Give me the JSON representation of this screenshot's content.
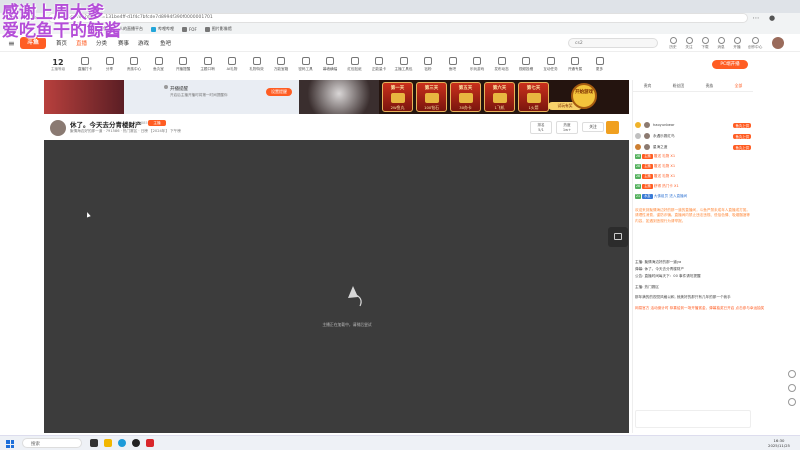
{
  "overlay": {
    "line1": "感谢上周大爹",
    "line2": "爱吃鱼干的鲸酱"
  },
  "browser": {
    "url": "douyu.com/1?dyshid=131be4ff-d1f4c7bfcde7d8994f390f0000001701",
    "bookmarks": [
      "斗鱼 - 每个人的直播平台",
      "哔哩哔哩",
      "FOF",
      "图片影像馆"
    ]
  },
  "site": {
    "logo": "斗鱼",
    "nav": [
      "首页",
      "直播",
      "分类",
      "赛事",
      "游戏",
      "鱼吧"
    ],
    "active_nav": "直播",
    "search_placeholder": "cs2",
    "header_icons": [
      "历史",
      "关注",
      "下载",
      "消息",
      "开播",
      "创作中心"
    ]
  },
  "toolbar": {
    "level": "12",
    "level_label": "主播等级",
    "tools": [
      "直播打卡",
      "分享",
      "贵族中心",
      "鱼丸宝",
      "开播提醒",
      "主题口哨",
      "AI礼物",
      "礼物特效",
      "万能宝箱",
      "密码工具",
      "幕墙横幅",
      "红包贴纸",
      "正能量卡",
      "主播工具包",
      "钻粉",
      "鱼吧",
      "乐玩游戏",
      "发布动态",
      "视频投稿",
      "互动任务",
      "开通专属",
      "更多"
    ],
    "charge_button": "PC端开播"
  },
  "banner": {
    "popup_title": "开播提醒",
    "popup_sub": "开启后主播开播时将第一时间提醒你",
    "popup_button": "设置提醒",
    "days": [
      {
        "day": "第一天",
        "prize": "2W鱼丸"
      },
      {
        "day": "第三天",
        "prize": "100钻石"
      },
      {
        "day": "第五天",
        "prize": "30办卡"
      },
      {
        "day": "第六天",
        "prize": "1飞机"
      },
      {
        "day": "第七天",
        "prize": "1火箭"
      }
    ],
    "trial": "试玩有奖",
    "start": "开始游戏"
  },
  "room": {
    "title": "休了。今天去分青楼财产",
    "id": "9158858",
    "tag": "主播",
    "meta": "聚情海边好的那一道  · 791586  · 热门赛区  · 日榜 【2024年】 下午榜 ",
    "rank_label": "排名",
    "rank_value": "5/1",
    "hot_label": "热度",
    "hot_value": "1w+",
    "follow": "关注",
    "follow_count": "2W+"
  },
  "video": {
    "loading_text": "主播正在加载中，请稍后尝试"
  },
  "right_panel": {
    "tabs": [
      "贵宾",
      "粉丝团",
      "贵族",
      "全部"
    ],
    "top_rank": [
      {
        "name": "haoyunbear",
        "badge": "鱼丸上供"
      },
      {
        "name": "永遇乐赛红鸟",
        "badge": "鱼丸上供"
      },
      {
        "name": "星海之渡",
        "badge": "鱼丸上供"
      }
    ],
    "chats": [
      {
        "lv": "28",
        "badge": "主播",
        "text": "赠送 礼物 X1"
      },
      {
        "lv": "28",
        "badge": "主播",
        "text": "赠送 礼物 X1"
      },
      {
        "lv": "28",
        "badge": "主播",
        "text": "赠送 礼物 X1"
      },
      {
        "lv": "28",
        "badge": "主播",
        "text": "获得 热门卡 X1"
      },
      {
        "lv": "21",
        "badge": "水友",
        "text": "大佛组员 进入直播间"
      }
    ],
    "notice": "欢迎来到聚情海边好的那一道的直播间，斗鱼严禁未成年人直播或打赏。请理性消费，谨防诈骗。直播间内禁止违法违规、低俗色情、吸烟酗酒等内容，如遇到违规行为请举报。",
    "messages": [
      {
        "user": "主播",
        "text": "聚情海边好的那一道ya"
      },
      {
        "user": "弹幕",
        "text": "休了。今天去分青楼财产"
      },
      {
        "user": "公告",
        "text": "直播时间每天下：00 事件请勿提醒"
      },
      {
        "user": "主播",
        "text": "热门赛区"
      }
    ],
    "last_message": "那年满的的视觉风格以和, 就美好的那只有几年的那一个我手",
    "promo_title": "网易官方",
    "promo_text": "活动倒计时 恭喜给到一场开播赏金，弹幕抽奖已开启 点击参与幸运抽奖"
  },
  "taskbar": {
    "search": "搜索",
    "time": "16:30",
    "date": "2025/11/25"
  }
}
